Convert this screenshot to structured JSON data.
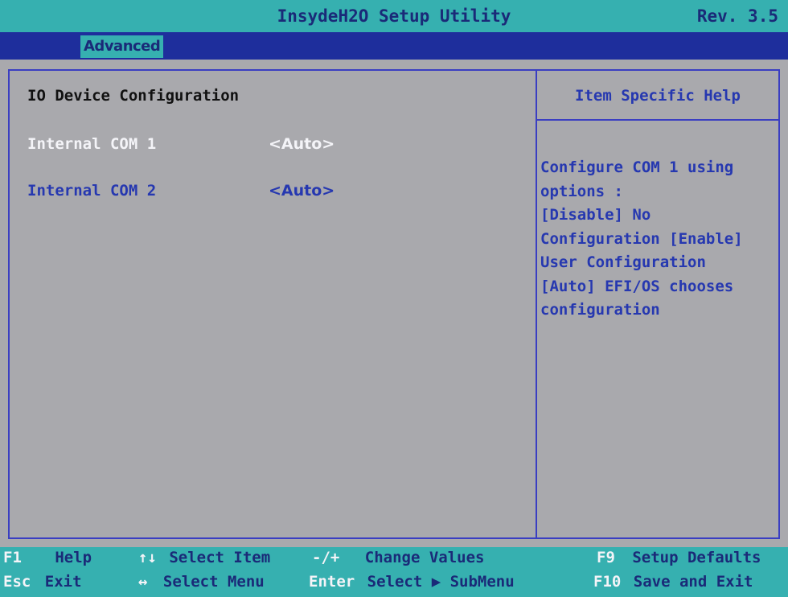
{
  "title_bar": {
    "title": "InsydeH2O Setup Utility",
    "rev": "Rev. 3.5"
  },
  "menu": {
    "active_tab": "Advanced"
  },
  "main": {
    "section_title": "IO Device Configuration",
    "items": [
      {
        "label": "Internal COM 1",
        "value": "<Auto>",
        "selected": true
      },
      {
        "label": "Internal COM 2",
        "value": "<Auto>",
        "selected": false
      }
    ]
  },
  "help": {
    "title": "Item Specific Help",
    "lines": [
      "Configure COM 1 using",
      "options :",
      "[Disable] No",
      "Configuration [Enable]",
      "User Configuration",
      "[Auto] EFI/OS chooses",
      "configuration"
    ]
  },
  "footer": {
    "row1": [
      {
        "key": "F1",
        "desc": "Help"
      },
      {
        "key": "↑↓",
        "desc": "Select Item"
      },
      {
        "key": "-/+",
        "desc": "Change Values"
      },
      {
        "key": "F9",
        "desc": "Setup Defaults"
      }
    ],
    "row2": [
      {
        "key": "Esc",
        "desc": "Exit"
      },
      {
        "key": "↔",
        "desc": "Select Menu"
      },
      {
        "key": "Enter",
        "desc": "Select ▶ SubMenu"
      },
      {
        "key": "F10",
        "desc": "Save and Exit"
      }
    ]
  },
  "colors": {
    "background": "#a9a9ad",
    "header_teal": "#36b0b0",
    "menu_blue": "#1e2e9c",
    "text_blue": "#2638b0",
    "highlight_white": "#f4f4f8"
  }
}
